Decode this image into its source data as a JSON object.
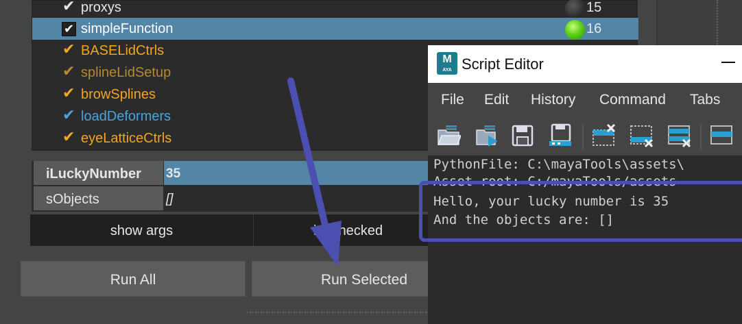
{
  "tree": {
    "rows": [
      {
        "label": "proxys",
        "index": "15",
        "check": "✔",
        "check_color": "#e6e6e6",
        "label_color": "#e6e6e6",
        "dot": "dark"
      },
      {
        "label": "simpleFunction",
        "index": "16",
        "check": "✔",
        "check_color": "#ffffff",
        "label_color": "#ffffff",
        "dot": "green"
      },
      {
        "label": "BASELidCtrls",
        "check": "✔",
        "check_color": "#f2a521",
        "label_color": "#f2a521"
      },
      {
        "label": "splineLidSetup",
        "check": "✔",
        "check_color": "#b8892e",
        "label_color": "#b8892e"
      },
      {
        "label": "browSplines",
        "check": "✔",
        "check_color": "#f2a521",
        "label_color": "#f2a521"
      },
      {
        "label": "loadDeformers",
        "check": "✔",
        "check_color": "#4aa3df",
        "label_color": "#4aa3df"
      },
      {
        "label": "eyeLatticeCtrls",
        "check": "✔",
        "check_color": "#f2a521",
        "label_color": "#f2a521"
      }
    ]
  },
  "args": {
    "rows": [
      {
        "name": "iLuckyNumber",
        "value": "35"
      },
      {
        "name": "sObjects",
        "value": "[]"
      }
    ]
  },
  "buttons": {
    "show_args": "show args",
    "invert_checked": "ite checked",
    "run_all": "Run All",
    "run_selected": "Run Selected"
  },
  "script_editor": {
    "title": "Script Editor",
    "logo_letter": "M",
    "logo_sub": "AYA",
    "menu": [
      "File",
      "Edit",
      "History",
      "Command",
      "Tabs"
    ],
    "output": [
      "PythonFile:  C:\\mayaTools\\assets\\",
      "Asset root:  C:/mayaTools/assets",
      "Hello, your lucky number is 35",
      "And the objects are: []"
    ]
  },
  "colors": {
    "selection": "#5285a6",
    "annotation": "#4b4fb0"
  }
}
